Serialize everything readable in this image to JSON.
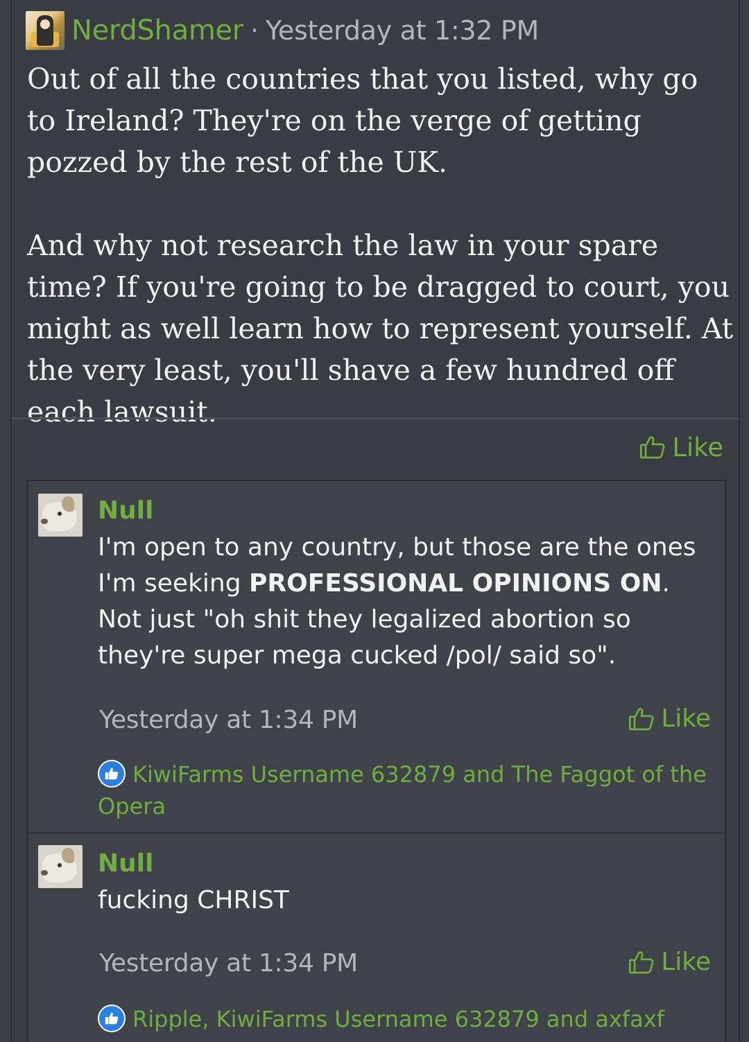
{
  "post": {
    "author": "NerdShamer",
    "separator": "·",
    "time": "Yesterday at 1:32 PM",
    "paragraphs": [
      "Out of all the countries that you listed, why go to Ireland? They're on the verge of getting pozzed by the rest of the UK.",
      "And why not research the law in your spare time? If you're going to be dragged to court, you might as well learn how to represent yourself. At the very least, you'll shave a few hundred off each lawsuit."
    ],
    "like_label": "Like"
  },
  "comments": [
    {
      "author": "Null",
      "text_before": "I'm open to any country, but those are the ones I'm seeking ",
      "text_bold": "PROFESSIONAL OPINIONS ON",
      "text_after": ". Not just \"oh shit they legalized abortion so they're super mega cucked /pol/ said so\".",
      "time": "Yesterday at 1:34 PM",
      "like_label": "Like",
      "liked_by": "KiwiFarms Username 632879 and The Faggot of the Opera"
    },
    {
      "author": "Null",
      "text": "fucking CHRIST",
      "time": "Yesterday at 1:34 PM",
      "like_label": "Like",
      "liked_by": "Ripple, KiwiFarms Username 632879 and axfaxf"
    }
  ],
  "colors": {
    "accent_green": "#6fae3f",
    "background": "#3b3e44",
    "like_badge_blue": "#2a7fe0"
  },
  "icons": [
    "thumbs-up-outline-icon",
    "thumbs-up-badge-icon",
    "avatar"
  ]
}
